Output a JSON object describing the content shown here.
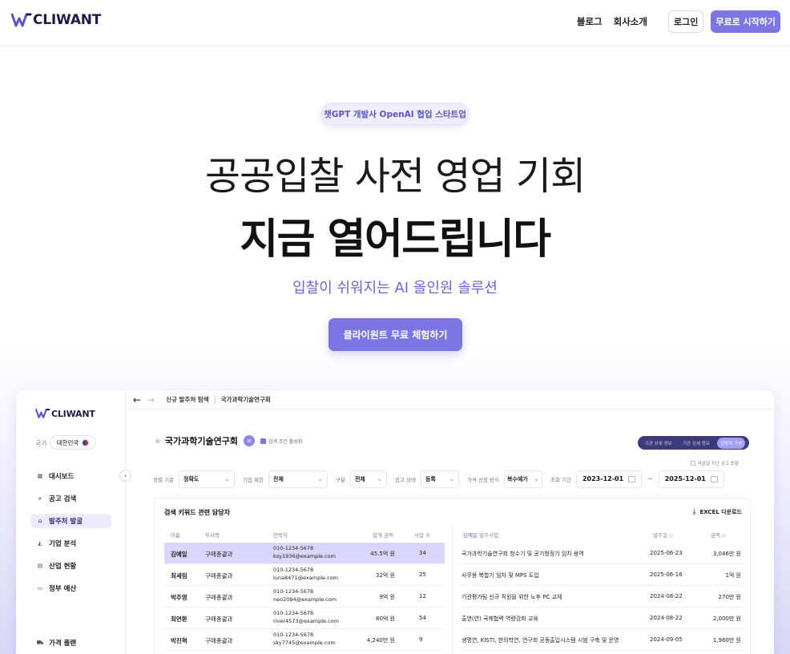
{
  "brand": {
    "name": "CLIWANT",
    "color": "#7b76e4"
  },
  "nav": {
    "links": [
      "블로그",
      "회사소개"
    ],
    "login": "로그인",
    "start": "무료로 시작하기"
  },
  "hero": {
    "pill": "챗GPT 개발사 OpenAI 협업 스타트업",
    "line1": "공공입찰 사전 영업 기회",
    "line2": "지금 열어드립니다",
    "sub": "입찰이 쉬워지는 AI 올인원 솔루션",
    "cta": "클라이원트 무료 체험하기"
  },
  "app": {
    "sidebar": {
      "country_label": "국가",
      "country": "대한민국",
      "collapse": "‹",
      "items": [
        {
          "label": "대시보드",
          "icon": "dashboard-icon",
          "glyph": "▦"
        },
        {
          "label": "공고 검색",
          "icon": "search-icon",
          "glyph": "⌕"
        },
        {
          "label": "발주처 발굴",
          "icon": "building-icon",
          "glyph": "⌂"
        },
        {
          "label": "기업 분석",
          "icon": "chart-icon",
          "glyph": "◭"
        },
        {
          "label": "산업 현황",
          "icon": "industry-icon",
          "glyph": "▤"
        },
        {
          "label": "정부 예산",
          "icon": "budget-icon",
          "glyph": "▭"
        },
        {
          "label": "가격 플랜",
          "icon": "cart-icon",
          "glyph": "⛟"
        }
      ]
    },
    "breadcrumb": [
      "신규 발주처 탐색",
      "국가과학기술연구회"
    ],
    "title": "국가과학기술연구회",
    "filter_badge": "≡",
    "checkbox_label": "검색 조건 활성화",
    "segments": [
      "기관 상세 정보",
      "기관 상세 정보",
      "담당자 구성"
    ],
    "expired_label": "마감일 지난 공고 포함",
    "filters": [
      {
        "label": "정렬 기준",
        "value": "정확도"
      },
      {
        "label": "기업 제한",
        "value": "전체"
      },
      {
        "label": "구분",
        "value": "전체"
      },
      {
        "label": "공고 상태",
        "value": "등록"
      },
      {
        "label": "가격 선정 방식",
        "value": "복수예가"
      }
    ],
    "period_label": "조회 기간",
    "date_from": "2023-12-01",
    "date_sep": "~",
    "date_to": "2025-12-01",
    "panel_title": "검색 키워드 관련 담당자",
    "excel": "EXCEL 다운로드",
    "left_headers": [
      "이름",
      "부서명",
      "연락처",
      "합계 금액",
      "사업 수"
    ],
    "contacts": [
      {
        "name": "김예일",
        "dept": "구매총괄과",
        "phone": "010-1234-5678",
        "email": "ksy1936@example.com",
        "amount": "45.5억 원",
        "count": "34"
      },
      {
        "name": "최세림",
        "dept": "구매총괄과",
        "phone": "010-1234-5678",
        "email": "luna8471@example.com",
        "amount": "32억 원",
        "count": "25"
      },
      {
        "name": "박주영",
        "dept": "구매총괄과",
        "phone": "010-1234-5678",
        "email": "neo2094@example.com",
        "amount": "9억 원",
        "count": "12"
      },
      {
        "name": "최연환",
        "dept": "구매총괄과",
        "phone": "010-1234-5678",
        "email": "river4573@example.com",
        "amount": "80억 원",
        "count": "54"
      },
      {
        "name": "박진혁",
        "dept": "구매총괄과",
        "phone": "010-1234-5678",
        "email": "sky7745@example.com",
        "amount": "4,240만 원",
        "count": "9"
      }
    ],
    "right_headers": {
      "who": "김예일",
      "rest": " 발주사업",
      "date": "발주일",
      "amount": "금액"
    },
    "projects": [
      {
        "name": "국가과학기술연구회 청수기 및 공기청정기 임차 용역",
        "date": "2025-06-23",
        "amount": "3,046만 원"
      },
      {
        "name": "사무용 복합기 임차 및 MPS 도입",
        "date": "2025-06-16",
        "amount": "1억 원"
      },
      {
        "name": "기관평가팀 신규 직원을 위한 노후 PC 교체",
        "date": "2024-08-22",
        "amount": "270만 원"
      },
      {
        "name": "출연(연) 국제협력 역량강화 교육",
        "date": "2024-08-22",
        "amount": "2,000만 원"
      },
      {
        "name": "생명연, KISTI, 한의학연, 연구회 공동출입시스템 시범 구축 및 운영",
        "date": "2024-09-05",
        "amount": "1,980만 원"
      }
    ]
  }
}
